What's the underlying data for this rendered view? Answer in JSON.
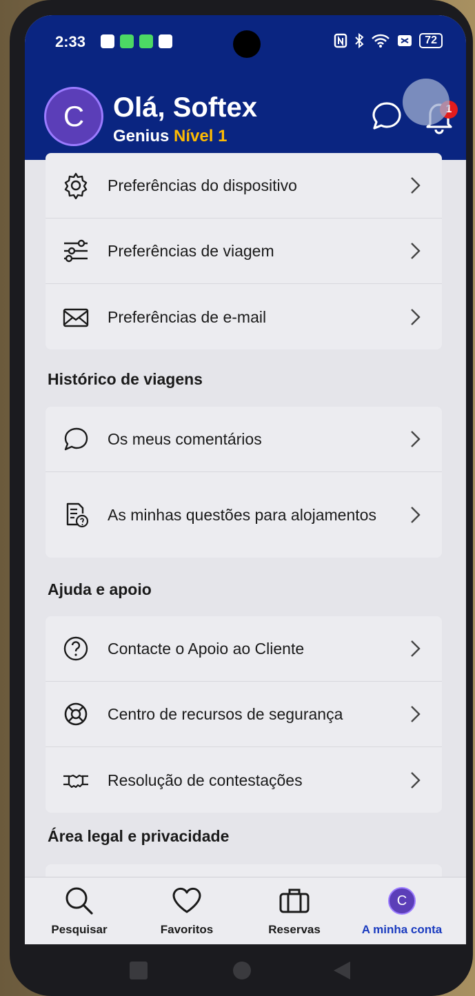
{
  "status": {
    "time": "2:33",
    "battery": "72"
  },
  "header": {
    "avatar_initial": "C",
    "greeting": "Olá, Softex",
    "genius_label": "Genius",
    "genius_level": "Nível 1",
    "notification_count": "1"
  },
  "settings": {
    "items": [
      {
        "label": "Preferências do dispositivo",
        "icon": "gear-icon"
      },
      {
        "label": "Preferências de viagem",
        "icon": "sliders-icon"
      },
      {
        "label": "Preferências de e-mail",
        "icon": "envelope-icon"
      }
    ]
  },
  "history": {
    "title": "Histórico de viagens",
    "items": [
      {
        "label": "Os meus comentários",
        "icon": "speech-bubble-icon"
      },
      {
        "label": "As minhas questões para alojamentos",
        "icon": "question-document-icon"
      }
    ]
  },
  "help": {
    "title": "Ajuda e apoio",
    "items": [
      {
        "label": "Contacte o Apoio ao Cliente",
        "icon": "question-circle-icon"
      },
      {
        "label": "Centro de recursos de segurança",
        "icon": "lifebuoy-icon"
      },
      {
        "label": "Resolução de contestações",
        "icon": "handshake-icon"
      }
    ]
  },
  "legal": {
    "title": "Área legal e privacidade"
  },
  "bottom_nav": {
    "items": [
      {
        "label": "Pesquisar",
        "icon": "search-icon"
      },
      {
        "label": "Favoritos",
        "icon": "heart-icon"
      },
      {
        "label": "Reservas",
        "icon": "suitcase-icon"
      },
      {
        "label": "A minha conta",
        "icon": "avatar"
      }
    ],
    "active_index": 3,
    "avatar_initial": "C"
  },
  "colors": {
    "brand": "#0a2581",
    "accent": "#febb02",
    "active_nav": "#1a3bbf"
  }
}
